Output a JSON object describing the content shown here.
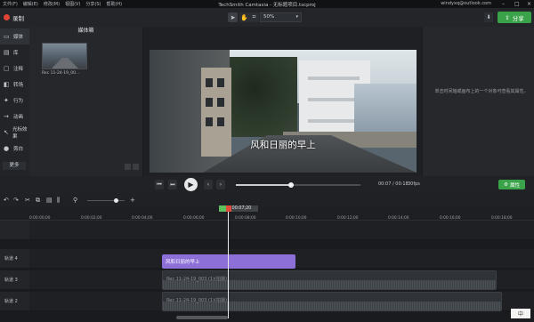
{
  "window": {
    "title": "TechSmith Camtasia - 无标题项目.tscproj",
    "account": "windyxq@outlook.com",
    "menus": [
      "文件(F)",
      "编辑(E)",
      "修改(M)",
      "视图(V)",
      "分享(S)",
      "帮助(H)"
    ]
  },
  "toolbar": {
    "record_label": "录制",
    "zoom_value": "50%",
    "share_label": "分享"
  },
  "sidebar": {
    "items": [
      {
        "label": "媒体",
        "icon": "media-icon"
      },
      {
        "label": "库",
        "icon": "library-icon"
      },
      {
        "label": "注释",
        "icon": "annotation-icon"
      },
      {
        "label": "转场",
        "icon": "transition-icon"
      },
      {
        "label": "行为",
        "icon": "behavior-icon"
      },
      {
        "label": "动画",
        "icon": "animation-icon"
      },
      {
        "label": "光标效果",
        "icon": "cursor-effect-icon"
      },
      {
        "label": "旁白",
        "icon": "voice-narration-icon"
      }
    ],
    "more_label": "更多",
    "add_label": "+"
  },
  "mediabin": {
    "header": "媒体箱",
    "clip_name": "Rec 11-24-19_00..."
  },
  "canvas": {
    "subtitle": "风和日丽的早上"
  },
  "properties": {
    "hint": "单击时间轴或画布上的一个对象可查看其属性。"
  },
  "playback": {
    "current_time": "00:07",
    "total_time": "00:18",
    "time_display": "00:07 / 00:18",
    "fps": "30fps",
    "position_fraction": 0.44,
    "properties_button": "属性"
  },
  "timeline": {
    "playhead_time": "0:00:07;20",
    "ruler_ticks": [
      "0:00:00;00",
      "0:00:02;00",
      "0:00:04;00",
      "0:00:06;00",
      "0:00:08;00",
      "0:00:10;00",
      "0:00:12;00",
      "0:00:14;00",
      "0:00:16;00",
      "0:00:18;00"
    ],
    "tracks": [
      {
        "label": "轨道 4"
      },
      {
        "label": "轨道 3"
      },
      {
        "label": "轨道 2"
      }
    ],
    "caption_clip": "风和日丽的早上",
    "audio_clip_1": "Rec 11-24-19_003 (1)(拍摄)",
    "audio_clip_2": "Rec 11-24-19_003 (1)(拍摄)"
  },
  "ime": {
    "label": "中"
  },
  "colors": {
    "accent_green": "#3aa34a",
    "record_red": "#e04437",
    "caption_clip": "#8d6fd8"
  }
}
